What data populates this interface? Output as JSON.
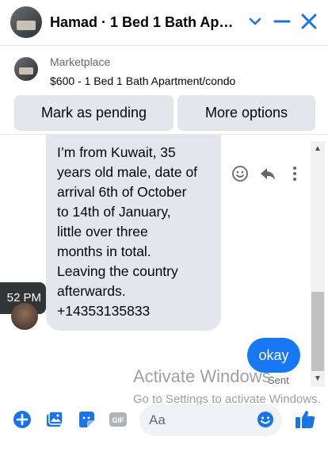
{
  "header": {
    "title": "Hamad · 1 Bed 1 Bath Apar…",
    "icons": [
      "chevron-down-icon",
      "minimize-icon",
      "close-icon"
    ]
  },
  "marketplace": {
    "label": "Marketplace",
    "item": "$600 - 1 Bed 1 Bath Apartment/condo",
    "buttons": {
      "pending": "Mark as pending",
      "more": "More options"
    }
  },
  "thread": {
    "incoming_lines": [
      "I’m from Kuwait, 35",
      "years old male, date of",
      "arrival 6th of October",
      "to 14th of January,",
      "little over three",
      "months in total.",
      "Leaving the country",
      "afterwards.",
      "+14353135833"
    ],
    "timestamp": "52 PM",
    "outgoing": "okay",
    "status": "Sent"
  },
  "watermark": {
    "line1": "Activate Windows",
    "line2": "Go to Settings to activate Windows."
  },
  "composer": {
    "placeholder": "Aa",
    "icons": [
      "plus-icon",
      "image-icon",
      "sticker-icon",
      "gif-icon",
      "emoji-icon",
      "like-icon"
    ]
  },
  "colors": {
    "accent": "#1877f2",
    "bubble_in": "#e4e6eb"
  }
}
